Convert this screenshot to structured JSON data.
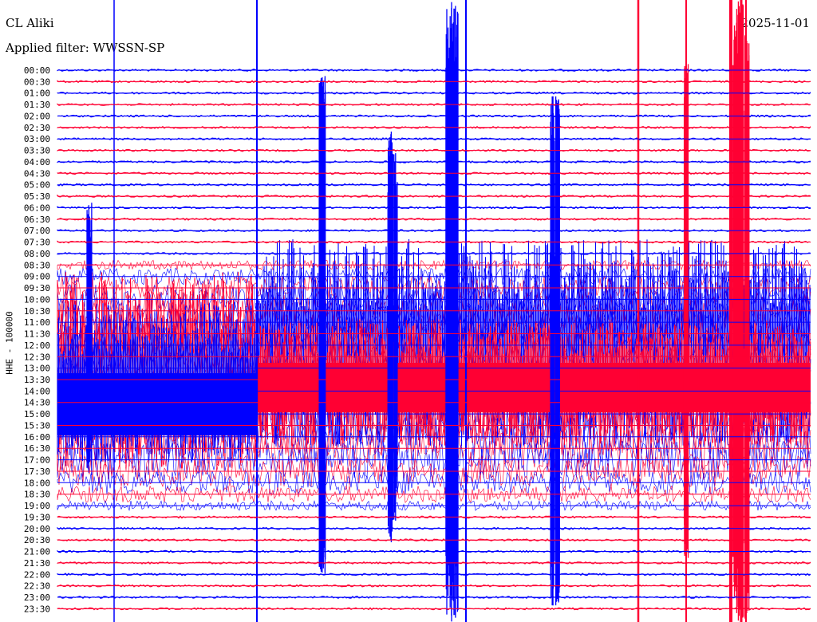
{
  "header": {
    "station": "CL Aliki",
    "filter": "Applied filter: WWSSN-SP",
    "date": "2025-11-01"
  },
  "channel_label": "HHE - 100000",
  "colors": {
    "blue": "#0000ff",
    "red": "#ff0033",
    "text": "#000000"
  },
  "chart_data": {
    "type": "line",
    "title": "CL Aliki",
    "xlabel": "",
    "ylabel": "HHE - 100000",
    "row_labels": [
      "00:00",
      "00:30",
      "01:00",
      "01:30",
      "02:00",
      "02:30",
      "03:00",
      "03:30",
      "04:00",
      "04:30",
      "05:00",
      "05:30",
      "06:00",
      "06:30",
      "07:00",
      "07:30",
      "08:00",
      "08:30",
      "09:00",
      "09:30",
      "10:00",
      "10:30",
      "11:00",
      "11:30",
      "12:00",
      "12:30",
      "13:00",
      "13:30",
      "14:00",
      "14:30",
      "15:00",
      "15:30",
      "16:00",
      "16:30",
      "17:00",
      "17:30",
      "18:00",
      "18:30",
      "19:00",
      "19:30",
      "20:00",
      "20:30",
      "21:00",
      "21:30",
      "22:00",
      "22:30",
      "23:00",
      "23:30"
    ],
    "row_colors": [
      "blue",
      "red"
    ],
    "grid": false,
    "notes": "Helicorder plot: each row is 30 minutes of seismic trace, alternating blue/red."
  }
}
